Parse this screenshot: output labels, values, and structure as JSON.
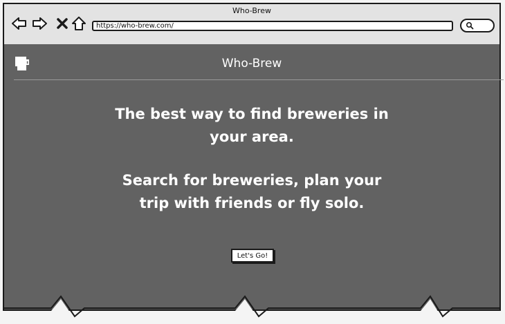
{
  "window": {
    "title": "Who-Brew"
  },
  "browser": {
    "url": "https://who-brew.com/",
    "icons": [
      "back-arrow-icon",
      "forward-arrow-icon",
      "close-x-icon",
      "home-icon",
      "search-icon"
    ]
  },
  "app": {
    "title": "Who-Brew",
    "logo_icon": "beer-mug-icon"
  },
  "hero": {
    "line1": "The best way to find breweries in your area.",
    "line2": "Search for breweries, plan your trip with friends or fly solo."
  },
  "cta": {
    "label": "Let's Go!"
  },
  "colors": {
    "content_bg": "#626262",
    "chrome_bg": "#e3e3e3",
    "text_light": "#ffffff",
    "outline": "#1a1a1a"
  }
}
